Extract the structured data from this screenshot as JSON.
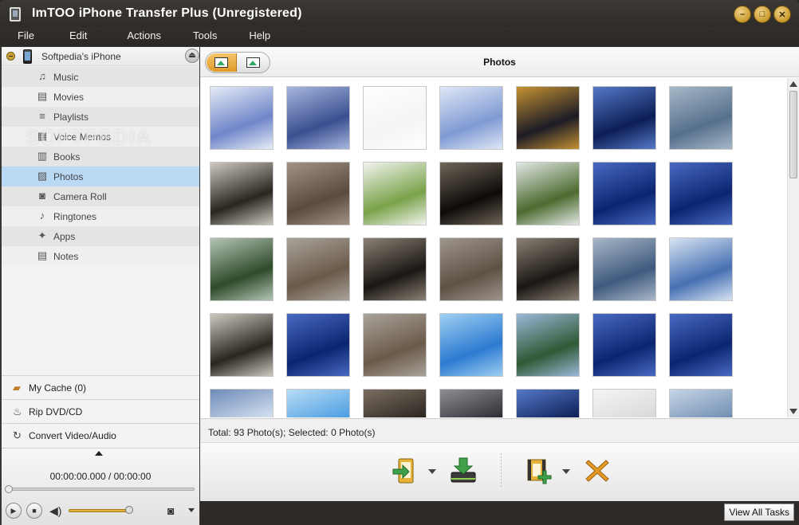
{
  "window": {
    "title": "ImTOO iPhone Transfer Plus (Unregistered)"
  },
  "menu": [
    "File",
    "Edit",
    "Actions",
    "Tools",
    "Help"
  ],
  "device": {
    "name": "Softpedia's iPhone"
  },
  "nav": [
    {
      "label": "Music",
      "icon": "music-icon",
      "glyph": "♫"
    },
    {
      "label": "Movies",
      "icon": "film-icon",
      "glyph": "▤"
    },
    {
      "label": "Playlists",
      "icon": "playlist-icon",
      "glyph": "≡"
    },
    {
      "label": "Voice Memos",
      "icon": "voice-memo-icon",
      "glyph": "▦"
    },
    {
      "label": "Books",
      "icon": "book-icon",
      "glyph": "▥"
    },
    {
      "label": "Photos",
      "icon": "photo-icon",
      "glyph": "▨",
      "selected": true
    },
    {
      "label": "Camera Roll",
      "icon": "camera-icon",
      "glyph": "◙"
    },
    {
      "label": "Ringtones",
      "icon": "ringtone-icon",
      "glyph": "♪"
    },
    {
      "label": "Apps",
      "icon": "apps-icon",
      "glyph": "✦"
    },
    {
      "label": "Notes",
      "icon": "notes-icon",
      "glyph": "▤"
    }
  ],
  "watermark": "SOFTPEDIA",
  "side_links": {
    "cache": "My Cache (0)",
    "rip": "Rip DVD/CD",
    "convert": "Convert Video/Audio"
  },
  "player": {
    "time": "00:00:00.000 / 00:00:00",
    "volume": 0.95
  },
  "main": {
    "title": "Photos",
    "status": "Total: 93 Photo(s); Selected: 0 Photo(s)"
  },
  "thumbnails": [
    [
      "#6f86c9",
      "#e6ecf7"
    ],
    [
      "#3a4f8f",
      "#a7b7df"
    ],
    [
      "#f4f4f4",
      "#ffffff"
    ],
    [
      "#7f9ad3",
      "#dfe7f6"
    ],
    [
      "#1c1b26",
      "#c59232"
    ],
    [
      "#0c1e55",
      "#5579c8"
    ],
    [
      "#56708c",
      "#a7b8c8"
    ],
    [
      "#2b2520",
      "#cdc9c0"
    ],
    [
      "#5b4a3d",
      "#a09385"
    ],
    [
      "#79a24a",
      "#f2f4ee"
    ],
    [
      "#0d0b09",
      "#6f6558"
    ],
    [
      "#4d6a2f",
      "#e2e8e5"
    ],
    [
      "#0b2570",
      "#4969c2"
    ],
    [
      "#0b2570",
      "#4969c2"
    ],
    [
      "#2f4a2a",
      "#b3c5b5"
    ],
    [
      "#6b5a4a",
      "#a9a39a"
    ],
    [
      "#1b1714",
      "#8b8174"
    ],
    [
      "#5e5246",
      "#9e958b"
    ],
    [
      "#1b1714",
      "#8b8174"
    ],
    [
      "#3f5a7e",
      "#a9b7c8"
    ],
    [
      "#4670b2",
      "#d7e3f2"
    ],
    [
      "#2b2520",
      "#cdc9c0"
    ],
    [
      "#0b2570",
      "#4969c2"
    ],
    [
      "#6b5a4a",
      "#a9a39a"
    ],
    [
      "#2c7ad1",
      "#9fd0f2"
    ],
    [
      "#2e5a35",
      "#9bb8d9"
    ],
    [
      "#0b2570",
      "#4969c2"
    ],
    [
      "#0b2570",
      "#4969c2"
    ],
    [
      "#d6e3f1",
      "#6d8ab8"
    ],
    [
      "#4a9de3",
      "#b8dcf4"
    ],
    [
      "#2b2520",
      "#7a6e60"
    ],
    [
      "#2b2d33",
      "#8d8f94"
    ],
    [
      "#0c1e55",
      "#5579c8"
    ],
    [
      "#d8d8d8",
      "#f5f5f5"
    ],
    [
      "#6f8db2",
      "#c6d5e6"
    ]
  ],
  "toolbar": [
    {
      "name": "transfer-to-device-button",
      "color": "#3fa24a"
    },
    {
      "name": "export-to-pc-button",
      "color": "#3fa24a"
    },
    {
      "name": "add-photos-button",
      "color": "#d8a21e"
    },
    {
      "name": "delete-button",
      "color": "#d8921e"
    }
  ],
  "bottom": {
    "tasks": "View All Tasks"
  }
}
